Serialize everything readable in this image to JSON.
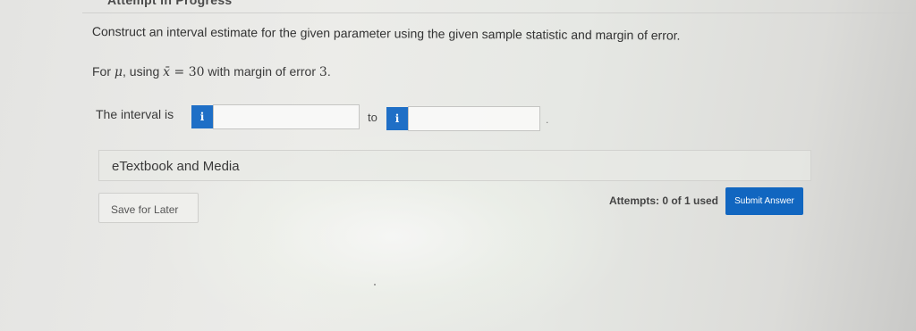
{
  "header": {
    "status_text": "Attempt in Progress"
  },
  "question": {
    "prompt": "Construct an interval estimate for the given parameter using the given sample statistic and margin of error.",
    "for_prefix": "For ",
    "parameter": "μ",
    "using_text": ", using ",
    "statistic": "x̄",
    "equals": " = ",
    "statistic_value": "30",
    "margin_text": " with margin of error ",
    "margin_value": "3",
    "end": "."
  },
  "answer": {
    "interval_label": "The interval is",
    "info_icon": "i",
    "lower_value": "",
    "to_label": "to",
    "upper_value": "",
    "period": "."
  },
  "resources": {
    "etextbook_label": "eTextbook and Media"
  },
  "footer": {
    "save_label": "Save for Later",
    "attempts_text": "Attempts: 0 of 1 used",
    "submit_label": "Submit Answer"
  },
  "colors": {
    "accent": "#1166c0",
    "info_button": "#1f6fc6"
  },
  "icons": {
    "info": "info-icon"
  }
}
